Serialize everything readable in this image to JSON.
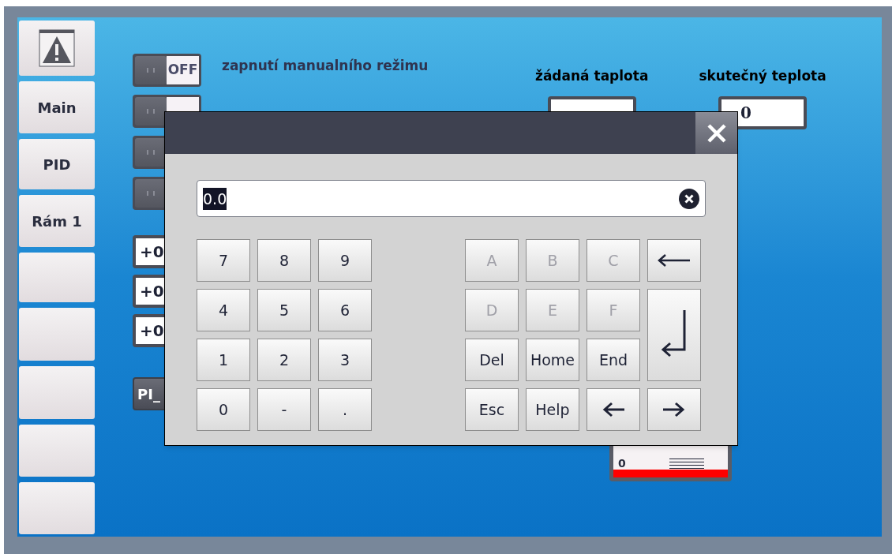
{
  "sidebar": {
    "items": [
      {
        "kind": "icon"
      },
      {
        "kind": "text",
        "label": "Main"
      },
      {
        "kind": "text",
        "label": "PID"
      },
      {
        "kind": "text",
        "label": "Rám 1"
      },
      {
        "kind": "blank"
      },
      {
        "kind": "blank"
      },
      {
        "kind": "blank"
      },
      {
        "kind": "blank"
      },
      {
        "kind": "blank"
      }
    ]
  },
  "switches": [
    {
      "on": false,
      "text": "OFF",
      "label": "zapnutí manualního režimu"
    },
    {
      "on": false
    },
    {
      "on": false
    },
    {
      "on": false
    }
  ],
  "value_fields": [
    "+0",
    "+0",
    "+0"
  ],
  "pi_button": "PI_",
  "temperatures": [
    {
      "label": "žádaná taplota"
    },
    {
      "label": "skutečný teplota",
      "value": "0"
    }
  ],
  "gauge": {
    "value": "0"
  },
  "dialog": {
    "input": {
      "value": "0.0"
    },
    "left_keys": [
      {
        "kind": "text",
        "label": "7",
        "disabled": false
      },
      {
        "kind": "text",
        "label": "8",
        "disabled": false
      },
      {
        "kind": "text",
        "label": "9",
        "disabled": false
      },
      {
        "kind": "text",
        "label": "4",
        "disabled": false
      },
      {
        "kind": "text",
        "label": "5",
        "disabled": false
      },
      {
        "kind": "text",
        "label": "6",
        "disabled": false
      },
      {
        "kind": "text",
        "label": "1",
        "disabled": false
      },
      {
        "kind": "text",
        "label": "2",
        "disabled": false
      },
      {
        "kind": "text",
        "label": "3",
        "disabled": false
      },
      {
        "kind": "text",
        "label": "0",
        "disabled": false
      },
      {
        "kind": "text",
        "label": "-",
        "disabled": false
      },
      {
        "kind": "text",
        "label": ".",
        "disabled": false
      }
    ],
    "right_keys": [
      {
        "kind": "text",
        "label": "A",
        "disabled": true
      },
      {
        "kind": "text",
        "label": "B",
        "disabled": true
      },
      {
        "kind": "text",
        "label": "C",
        "disabled": true
      },
      {
        "kind": "backspace",
        "disabled": false
      },
      {
        "kind": "text",
        "label": "D",
        "disabled": true
      },
      {
        "kind": "text",
        "label": "E",
        "disabled": true
      },
      {
        "kind": "text",
        "label": "F",
        "disabled": true
      },
      {
        "kind": "enter",
        "disabled": false
      },
      {
        "kind": "text",
        "label": "Del",
        "disabled": false
      },
      {
        "kind": "text",
        "label": "Home",
        "disabled": false
      },
      {
        "kind": "text",
        "label": "End",
        "disabled": false
      },
      {
        "kind": "text",
        "label": "Esc",
        "disabled": false
      },
      {
        "kind": "text",
        "label": "Help",
        "disabled": false
      },
      {
        "kind": "left",
        "disabled": false
      },
      {
        "kind": "right",
        "disabled": false
      }
    ]
  }
}
